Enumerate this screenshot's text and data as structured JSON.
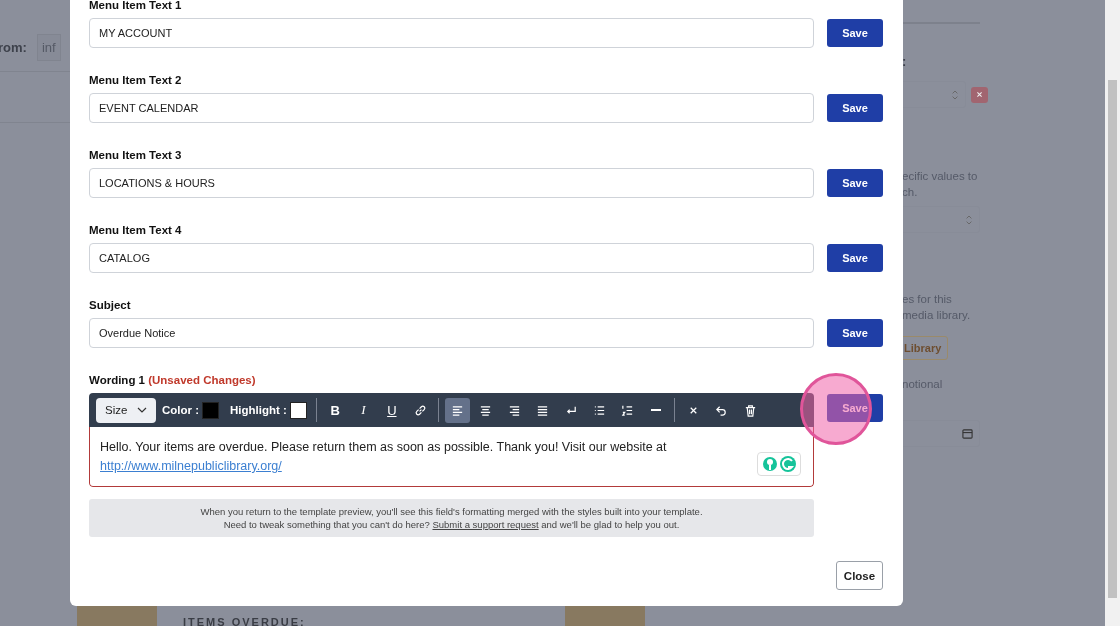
{
  "background": {
    "from_label": "rom:",
    "from_value": "inf",
    "right_colon": ":",
    "right_texts": [
      {
        "kind": "text",
        "text": "ecific values to"
      },
      {
        "kind": "text",
        "text": "ch."
      },
      {
        "kind": "select"
      },
      {
        "kind": "text",
        "text": "es for this"
      },
      {
        "kind": "text",
        "text": "media library."
      },
      {
        "kind": "button",
        "text": "Library"
      },
      {
        "kind": "text",
        "text": "notional"
      },
      {
        "kind": "date"
      }
    ],
    "preview_heading": "ITEMS OVERDUE:"
  },
  "modal": {
    "fields": [
      {
        "label": "Menu Item Text 1",
        "value": "MY ACCOUNT",
        "button": "Save"
      },
      {
        "label": "Menu Item Text 2",
        "value": "EVENT CALENDAR",
        "button": "Save"
      },
      {
        "label": "Menu Item Text 3",
        "value": "LOCATIONS & HOURS",
        "button": "Save"
      },
      {
        "label": "Menu Item Text 4",
        "value": "CATALOG",
        "button": "Save"
      },
      {
        "label": "Subject",
        "value": "Overdue Notice",
        "button": "Save"
      }
    ],
    "wording": {
      "label": "Wording 1",
      "status": "(Unsaved Changes)",
      "button": "Save",
      "clicked": true,
      "toolbar": {
        "size": "Size",
        "color_label": "Color :",
        "highlight_label": "Highlight :",
        "groups": [
          [
            {
              "kind": "bold",
              "label": "B",
              "selected": false
            },
            {
              "kind": "italic",
              "label": "I",
              "selected": false
            },
            {
              "kind": "underline",
              "label": "U",
              "selected": false
            },
            {
              "kind": "link",
              "selected": false
            }
          ],
          [
            {
              "kind": "align-left",
              "selected": true
            },
            {
              "kind": "align-center",
              "selected": false
            },
            {
              "kind": "align-right",
              "selected": false
            },
            {
              "kind": "justify",
              "selected": false
            },
            {
              "kind": "line-break",
              "selected": false
            },
            {
              "kind": "bullet-list",
              "selected": false
            },
            {
              "kind": "numbered-list",
              "selected": false
            },
            {
              "kind": "rule",
              "selected": false
            }
          ],
          [
            {
              "kind": "clear",
              "selected": false
            },
            {
              "kind": "undo",
              "selected": false
            },
            {
              "kind": "delete",
              "selected": false
            }
          ]
        ]
      },
      "text": "Hello. Your items are overdue. Please return them as soon as possible. Thank you! Visit our website at",
      "link": "http://www.milnepubliclibrary.org/"
    },
    "notice": {
      "line1": "When you return to the template preview, you'll see this field's formatting merged with the styles built into your template.",
      "line2_before": "Need to tweak something that you can't do here?",
      "link": "Submit a support request",
      "line2_after": "and we'll be glad to help you out."
    },
    "close": "Close"
  }
}
